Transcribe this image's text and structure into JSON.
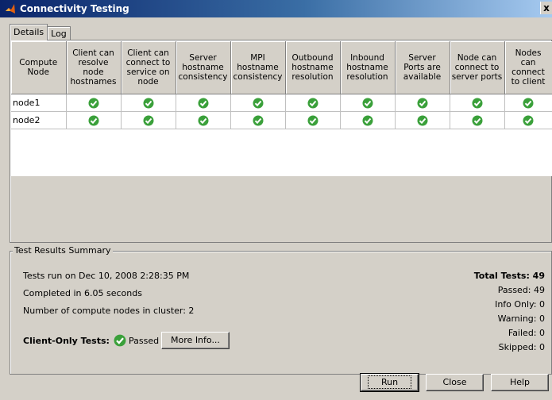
{
  "window": {
    "title": "Connectivity Testing",
    "close_label": "x"
  },
  "tabs": [
    {
      "label": "Details"
    },
    {
      "label": "Log"
    }
  ],
  "table": {
    "columns": [
      "Compute Node",
      "Client can resolve node hostnames",
      "Client can connect to service on node",
      "Server hostname consistency",
      "MPI hostname consistency",
      "Outbound hostname resolution",
      "Inbound hostname resolution",
      "Server Ports are available",
      "Node can connect to server ports",
      "Nodes can connect to client"
    ],
    "rows": [
      {
        "node": "node1",
        "results": [
          "passed",
          "passed",
          "passed",
          "passed",
          "passed",
          "passed",
          "passed",
          "passed",
          "passed"
        ]
      },
      {
        "node": "node2",
        "results": [
          "passed",
          "passed",
          "passed",
          "passed",
          "passed",
          "passed",
          "passed",
          "passed",
          "passed"
        ]
      }
    ]
  },
  "summary": {
    "legend": "Test Results Summary",
    "run_on": "Tests run on Dec 10, 2008 2:28:35 PM",
    "completed": "Completed in 6.05 seconds",
    "nodes": "Number of compute nodes in cluster: 2",
    "client_only_label": "Client-Only Tests:",
    "client_only_status": "Passed",
    "more_info_label": "More Info...",
    "total": "Total Tests: 49",
    "passed": "Passed: 49",
    "info_only": "Info Only: 0",
    "warning": "Warning: 0",
    "failed": "Failed: 0",
    "skipped": "Skipped: 0"
  },
  "buttons": {
    "run": "Run",
    "close": "Close",
    "help": "Help"
  },
  "colors": {
    "check": "#3aa03a",
    "title_start": "#0a246a",
    "title_end": "#a6caf0"
  }
}
